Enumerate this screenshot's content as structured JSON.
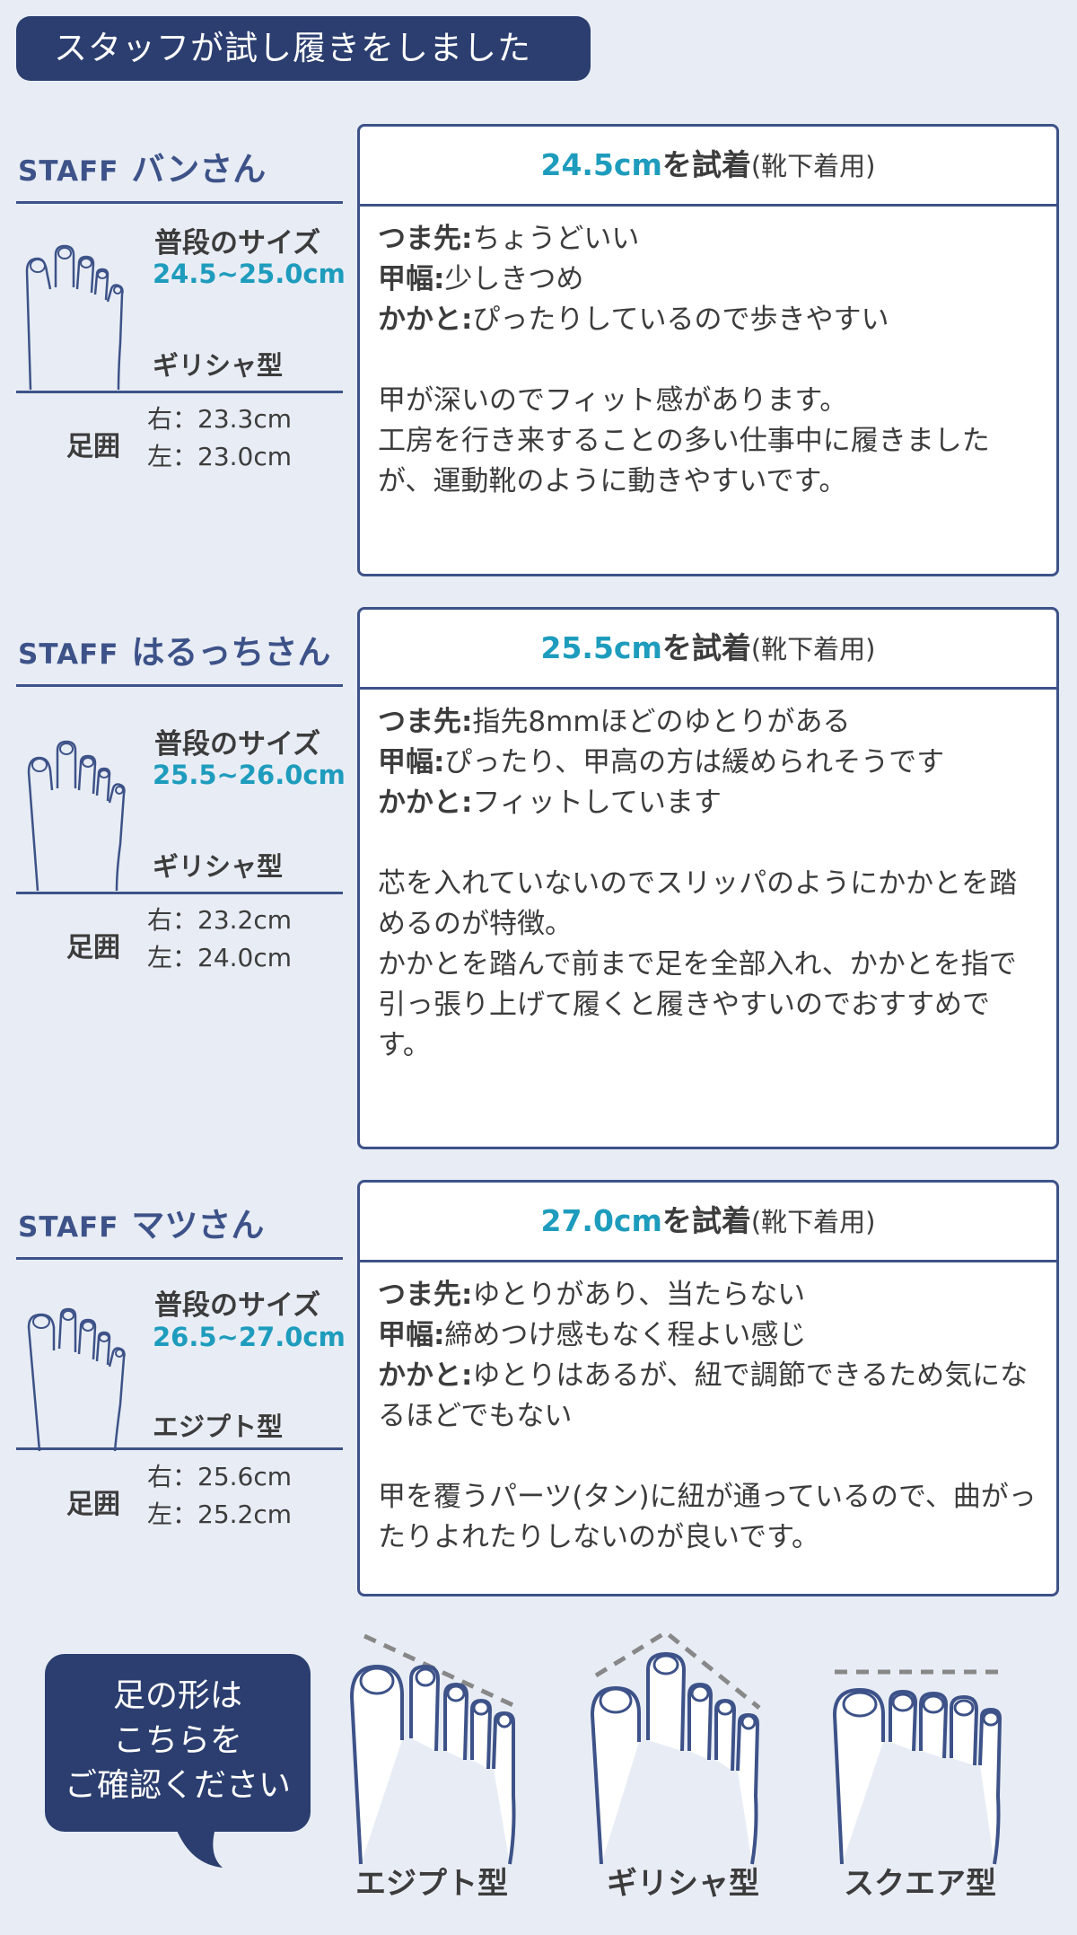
{
  "header": {
    "title": "スタッフが試し履きをしました"
  },
  "labels": {
    "staff_prefix": "STAFF",
    "usual_size": "普段のサイズ",
    "girth": "足囲",
    "tried_suffix": "を試着",
    "sock_note": "(靴下着用)"
  },
  "staff": [
    {
      "name": "バンさん",
      "usual_size": "24.5~25.0cm",
      "foot_type": "ギリシャ型",
      "girth_right": "右：23.3cm",
      "girth_left": "左：23.0cm",
      "tried_size": "24.5cm",
      "toe_label": "つま先:",
      "toe_text": "ちょうどいい",
      "instep_label": "甲幅:",
      "instep_text": "少しきつめ",
      "heel_label": "かかと:",
      "heel_text": "ぴったりしているので歩きやすい",
      "comment": "甲が深いのでフィット感があります。\n工房を行き来することの多い仕事中に履きましたが、運動靴のように動きやすいです。"
    },
    {
      "name": "はるっちさん",
      "usual_size": "25.5~26.0cm",
      "foot_type": "ギリシャ型",
      "girth_right": "右：23.2cm",
      "girth_left": "左：24.0cm",
      "tried_size": "25.5cm",
      "toe_label": "つま先:",
      "toe_text": "指先8mmほどのゆとりがある",
      "instep_label": "甲幅:",
      "instep_text": "ぴったり、甲高の方は緩められそうです",
      "heel_label": "かかと:",
      "heel_text": "フィットしています",
      "comment": "芯を入れていないのでスリッパのようにかかとを踏めるのが特徴。\nかかとを踏んで前まで足を全部入れ、かかとを指で引っ張り上げて履くと履きやすいのでおすすめです。"
    },
    {
      "name": "マツさん",
      "usual_size": "26.5~27.0cm",
      "foot_type": "エジプト型",
      "girth_right": "右：25.6cm",
      "girth_left": "左：25.2cm",
      "tried_size": "27.0cm",
      "toe_label": "つま先:",
      "toe_text": "ゆとりがあり、当たらない",
      "instep_label": "甲幅:",
      "instep_text": "締めつけ感もなく程よい感じ",
      "heel_label": "かかと:",
      "heel_text": "ゆとりはあるが、紐で調節できるため気になるほどでもない",
      "comment": "甲を覆うパーツ(タン)に紐が通っているので、曲がったりよれたりしないのが良いです。"
    }
  ],
  "footer": {
    "bubble": "足の形は\nこちらを\nご確認ください",
    "shapes": [
      "エジプト型",
      "ギリシャ型",
      "スクエア型"
    ]
  },
  "colors": {
    "navy": "#2b3e6f",
    "accent": "#1e9cbd",
    "line": "#3d5288"
  }
}
